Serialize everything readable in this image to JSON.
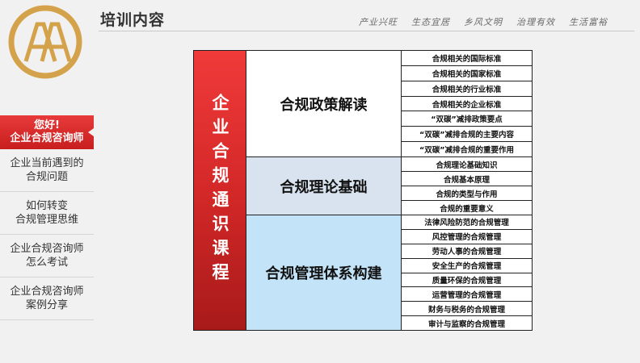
{
  "header": {
    "title": "培训内容",
    "nav": [
      "产业兴旺",
      "生态宜居",
      "乡风文明",
      "治理有效",
      "生活富裕"
    ]
  },
  "sidebar": {
    "active_line1": "您好!",
    "active_line2": "企业合规咨询师",
    "items": [
      {
        "line1": "企业当前遇到的",
        "line2": "合规问题"
      },
      {
        "line1": "如何转变",
        "line2": "合规管理思维"
      },
      {
        "line1": "企业合规咨询师",
        "line2": "怎么考试"
      },
      {
        "line1": "企业合规咨询师",
        "line2": "案例分享"
      }
    ]
  },
  "course": {
    "title": "企业合规通识课程",
    "groups": [
      {
        "name": "合规政策解读",
        "items": [
          "合规相关的国际标准",
          "合规相关的国家标准",
          "合规相关的行业标准",
          "合规相关的企业标准",
          "“双碳”减排政策要点",
          "“双碳”减排合规的主要内容",
          "“双碳”减排合规的重要作用"
        ]
      },
      {
        "name": "合规理论基础",
        "items": [
          "合规理论基础知识",
          "合规基本原理",
          "合规的类型与作用",
          "合规的重要意义"
        ]
      },
      {
        "name": "合规管理体系构建",
        "items": [
          "法律风险防范的合规管理",
          "风控管理的合规管理",
          "劳动人事的合规管理",
          "安全生产的合规管理",
          "质量环保的合规管理",
          "运营管理的合规管理",
          "财务与税务的合规管理",
          "审计与监察的合规管理"
        ]
      }
    ]
  },
  "colors": {
    "accent_red": "#d42828",
    "logo_gold": "#d4a24a"
  }
}
